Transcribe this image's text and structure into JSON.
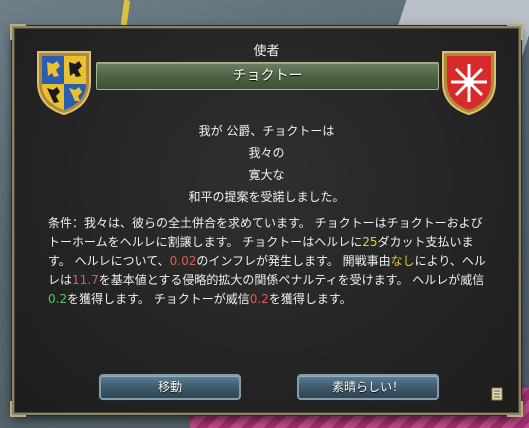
{
  "dialog": {
    "title": "使者",
    "banner": "チョクトー",
    "lines": [
      "我が 公爵、チョクトーは",
      "我々の",
      "寛大な",
      "和平の提案を受諾しました。"
    ],
    "terms": {
      "p1": "条件：我々は、彼らの全土併合を求めています。 チョクトーはチョクトーおよびトーホームをヘルレに割譲します。 チョクトーはヘルレに",
      "ducats": "25",
      "p2": "ダカット支払います。 ヘルレについて、",
      "inflation": "0.02",
      "p3": "のインフレが発生します。 開戦事由",
      "casus": "なし",
      "p4": "により、ヘルレは",
      "ae": "11.7",
      "p5": "を基本値とする侵略的拡大の関係ペナルティを受けます。 ヘルレが威信",
      "prestige_gain": "0.2",
      "p6": "を獲得します。 チョクトーが威信",
      "prestige_loss": "0.2",
      "p7": "を獲得します。"
    }
  },
  "buttons": {
    "move": "移動",
    "ok": "素晴らしい！"
  },
  "colors": {
    "negative": "#e05a5a",
    "highlight": "#e8c840",
    "positive": "#5cc25c"
  },
  "icons": {
    "left_shield": "guelders-coat-of-arms",
    "right_shield": "choctaw-coat-of-arms",
    "scroll": "scroll-icon"
  }
}
